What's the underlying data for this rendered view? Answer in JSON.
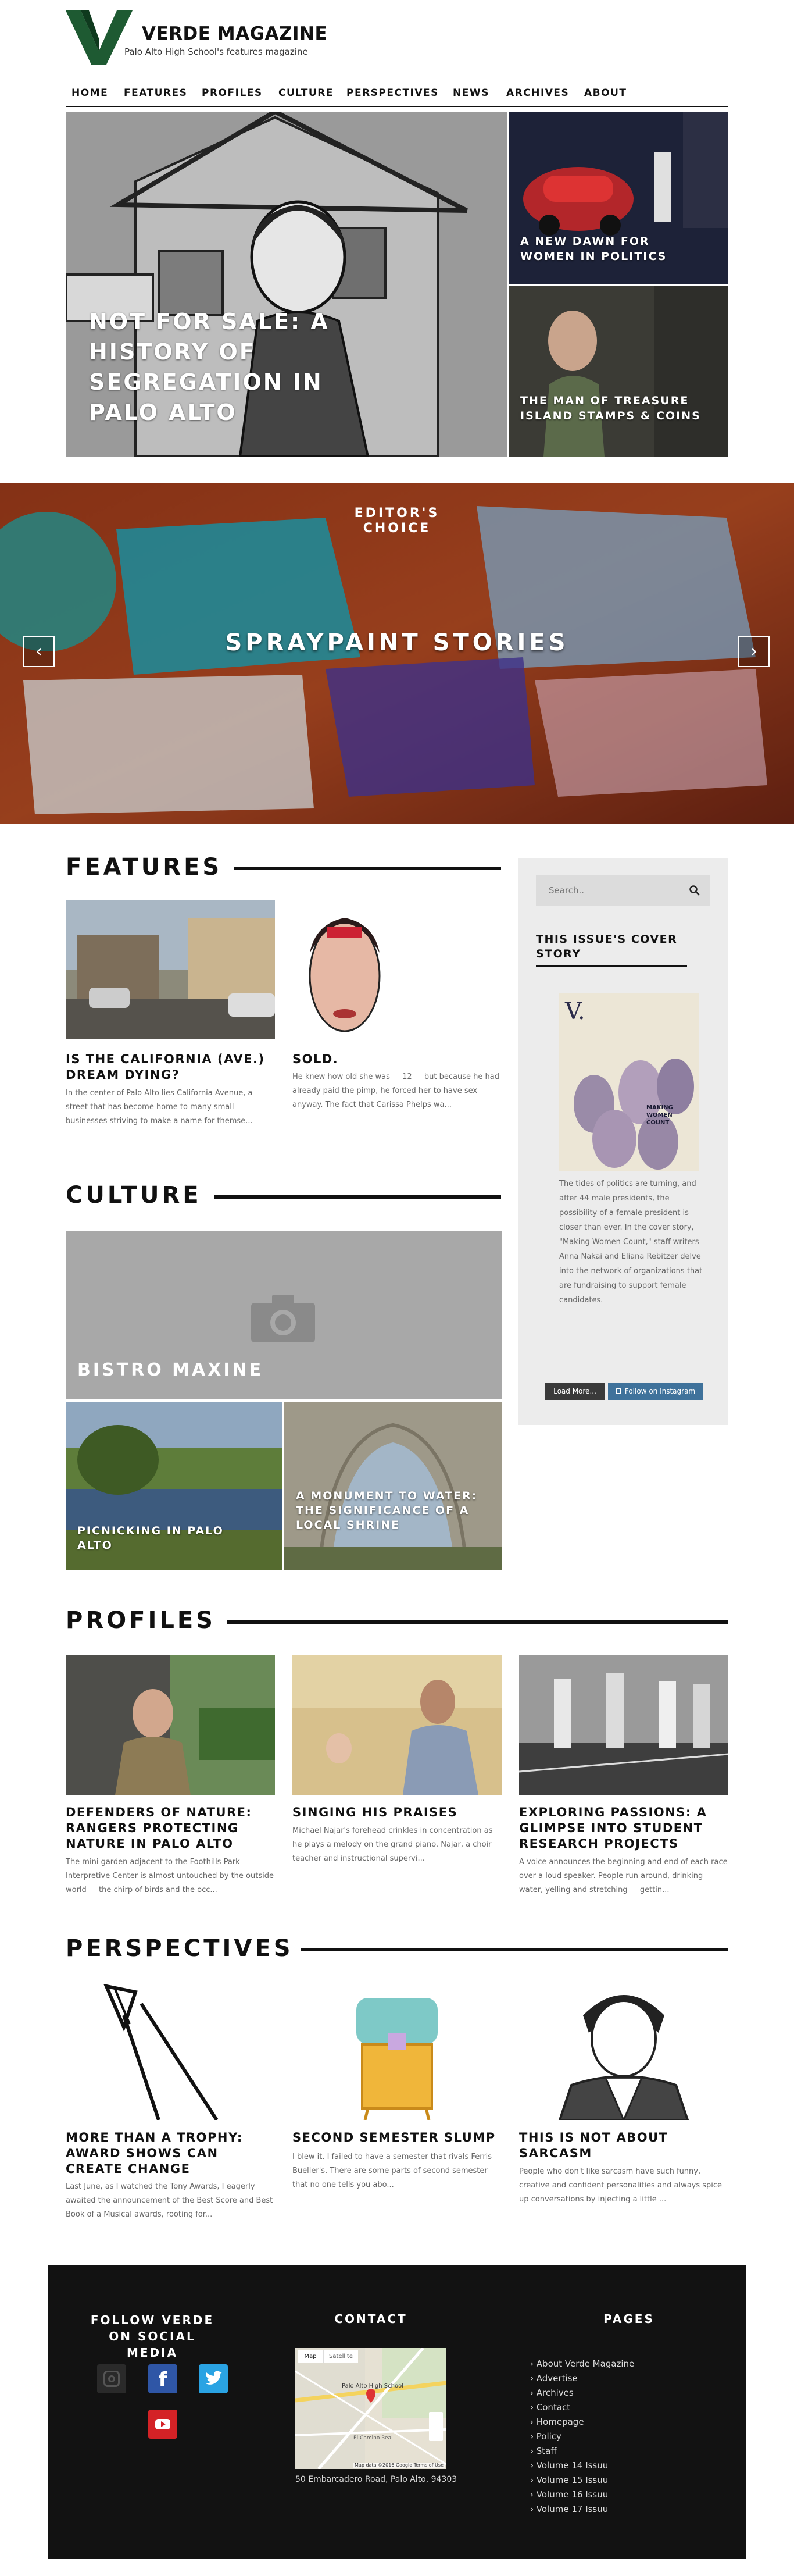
{
  "site": {
    "title": "VERDE MAGAZINE",
    "tagline": "Palo Alto High School's features magazine"
  },
  "nav": [
    "HOME",
    "FEATURES",
    "PROFILES",
    "CULTURE",
    "PERSPECTIVES",
    "NEWS",
    "ARCHIVES",
    "ABOUT"
  ],
  "hero": {
    "main": "NOT FOR SALE: A HISTORY OF SEGREGATION IN PALO ALTO",
    "top_right": "A NEW DAWN FOR WOMEN IN POLITICS",
    "bottom_right": "THE MAN OF TREASURE ISLAND STAMPS & COINS"
  },
  "carousel": {
    "kicker": "EDITOR'S CHOICE",
    "title": "SPRAYPAINT STORIES",
    "prev": "‹",
    "next": "›"
  },
  "features": {
    "heading": "FEATURES",
    "items": [
      {
        "title": "IS THE CALIFORNIA (AVE.) DREAM DYING?",
        "excerpt": "In the center of Palo Alto lies California Avenue, a street that has become home to many small businesses striving to make a name for themse..."
      },
      {
        "title": "SOLD.",
        "excerpt": "He knew how old she was — 12 — but because he had already paid the pimp, he forced her to have sex anyway. The fact that Carissa Phelps wa..."
      }
    ]
  },
  "culture": {
    "heading": "CULTURE",
    "main": "BISTRO MAXINE",
    "left": "PICNICKING IN PALO ALTO",
    "right": "A MONUMENT TO WATER: THE SIGNIFICANCE OF A LOCAL SHRINE"
  },
  "sidebar": {
    "search_placeholder": "Search..",
    "cover_heading": "THIS ISSUE'S COVER STORY",
    "cover_text": "The tides of politics are turning, and after 44 male presidents, the possibility of a female president is closer than ever. In the cover story, \"Making Women Count,\" staff writers Anna Nakai and Eliana Rebitzer delve into the network of organizations that are fundraising to support female candidates.",
    "cover_logo": "V.",
    "cover_words": "MAKING WOMEN COUNT",
    "load_more": "Load More...",
    "follow": "Follow on Instagram"
  },
  "profiles": {
    "heading": "PROFILES",
    "items": [
      {
        "title": "DEFENDERS OF NATURE: RANGERS PROTECTING NATURE IN PALO ALTO",
        "excerpt": "The mini garden adjacent to the Foothills Park Interpretive Center is almost untouched by the outside world — the chirp of birds and the occ..."
      },
      {
        "title": "SINGING HIS PRAISES",
        "excerpt": "Michael Najar's forehead crinkles in concentration as he plays a melody on the grand piano. Najar, a choir teacher and instructional supervi..."
      },
      {
        "title": "EXPLORING PASSIONS: A GLIMPSE INTO STUDENT RESEARCH PROJECTS",
        "excerpt": "A voice announces the beginning and end of each race over a loud speaker. People run around, drinking water, yelling and stretching — gettin..."
      }
    ]
  },
  "perspectives": {
    "heading": "PERSPECTIVES",
    "items": [
      {
        "title": "MORE THAN A TROPHY: AWARD SHOWS CAN CREATE CHANGE",
        "excerpt": "Last June, as I watched the Tony Awards, I eagerly awaited the announcement of the Best Score and Best Book of a Musical awards, rooting for..."
      },
      {
        "title": "SECOND SEMESTER SLUMP",
        "excerpt": "I blew it. I failed to have a semester that rivals Ferris Bueller's. There are some parts of second semester that no one tells you abo..."
      },
      {
        "title": "THIS IS NOT ABOUT SARCASM",
        "excerpt": "People who don't like sarcasm have such funny, creative and confident personalities and always spice up conversations by injecting a little ..."
      }
    ]
  },
  "footer": {
    "social_heading": "FOLLOW VERDE ON SOCIAL MEDIA",
    "contact_heading": "CONTACT",
    "pages_heading": "PAGES",
    "map_tabs": [
      "Map",
      "Satellite"
    ],
    "map_place": "Palo Alto High School",
    "map_road": "El Camino Real",
    "map_credit": "Map data ©2016 Google  Terms of Use",
    "address": "50 Embarcadero Road, Palo Alto, 94303",
    "pages": [
      "About Verde Magazine",
      "Advertise",
      "Archives",
      "Contact",
      "Homepage",
      "Policy",
      "Staff",
      "Volume 14 Issuu",
      "Volume 15 Issuu",
      "Volume 16 Issuu",
      "Volume 17 Issuu"
    ]
  },
  "colors": {
    "brand_green": "#1e5a32",
    "facebook": "#2f56a6",
    "twitter": "#2aa3e3",
    "youtube": "#d42226"
  }
}
